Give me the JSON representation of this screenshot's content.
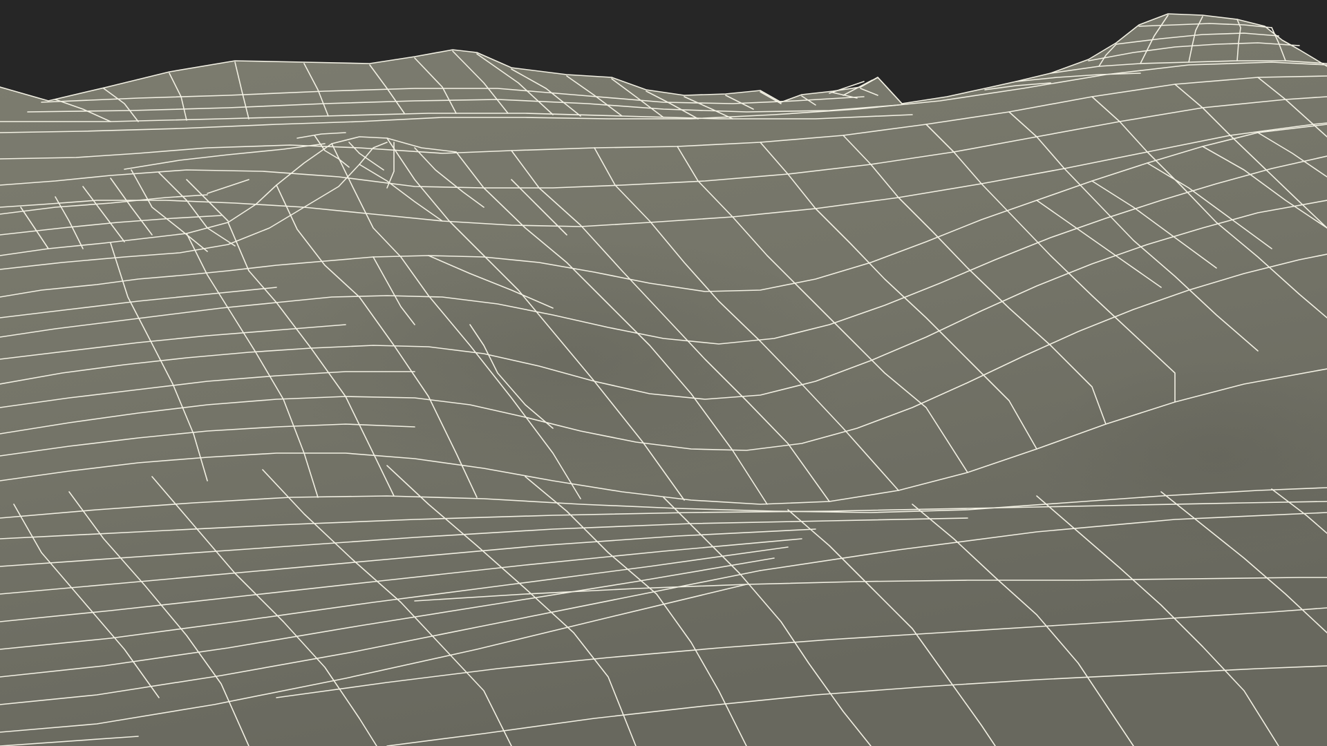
{
  "scene": {
    "background_color": "#262626",
    "surface_color_light": "#7d7d70",
    "surface_color_mid": "#747468",
    "surface_color_dark": "#68685e",
    "wire_color": "#f3f1e4",
    "render_style": "wireframe-over-shaded-terrain",
    "subject": "terrain-mesh"
  }
}
